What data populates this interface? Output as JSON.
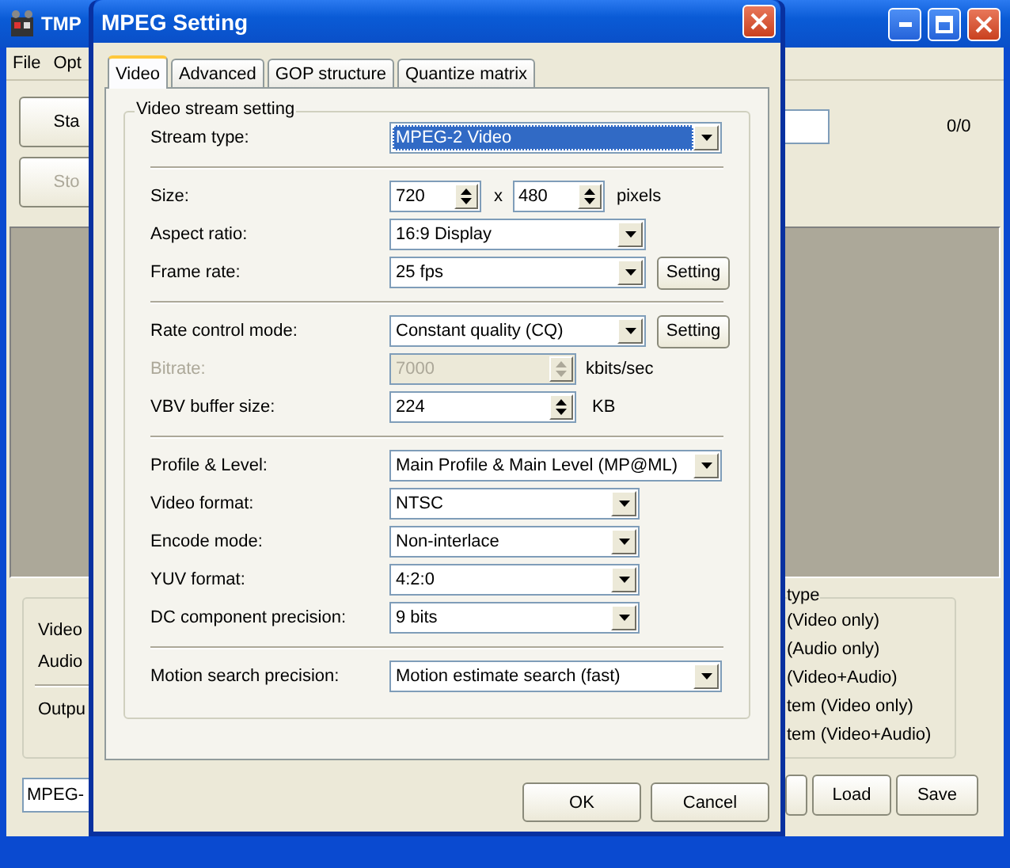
{
  "main_window": {
    "title": "TMP",
    "menu": [
      "File",
      "Opt"
    ],
    "side_buttons": [
      {
        "label": "Sta",
        "disabled": false
      },
      {
        "label": "Sto",
        "disabled": true
      }
    ],
    "counter": "0/0",
    "source_labels": [
      "Video",
      "Audio"
    ],
    "output_label": "Outpu",
    "legend": "type",
    "options": [
      "(Video only)",
      "(Audio only)",
      "(Video+Audio)",
      "tem (Video only)",
      "tem (Video+Audio)"
    ],
    "format_field": "MPEG-",
    "bottom_buttons": [
      "Load",
      "Save"
    ]
  },
  "dialog": {
    "title": "MPEG Setting",
    "tabs": [
      {
        "label": "Video",
        "selected": true
      },
      {
        "label": "Advanced",
        "selected": false
      },
      {
        "label": "GOP structure",
        "selected": false
      },
      {
        "label": "Quantize matrix",
        "selected": false
      }
    ],
    "group_title": "Video stream setting",
    "sections": [
      [
        {
          "label": "Stream type:",
          "kind": "select",
          "value": "MPEG-2 Video",
          "focused": true,
          "disabled": false
        }
      ],
      [
        {
          "label": "Size:",
          "kind": "size",
          "values": [
            "720",
            "480"
          ],
          "separator": "x",
          "unit": "pixels",
          "disabled": false
        },
        {
          "label": "Aspect ratio:",
          "kind": "select",
          "value": "16:9 Display",
          "focused": false,
          "disabled": false
        },
        {
          "label": "Frame rate:",
          "kind": "select",
          "value": "25 fps",
          "focused": false,
          "disabled": false,
          "button": "Setting"
        }
      ],
      [
        {
          "label": "Rate control mode:",
          "kind": "select",
          "value": "Constant quality (CQ)",
          "focused": false,
          "disabled": false,
          "button": "Setting"
        },
        {
          "label": "Bitrate:",
          "kind": "spin",
          "value": "7000",
          "unit": "kbits/sec",
          "disabled": true
        },
        {
          "label": "VBV buffer size:",
          "kind": "spin",
          "value": "224",
          "unit": "KB",
          "disabled": false
        }
      ],
      [
        {
          "label": "Profile & Level:",
          "kind": "select",
          "value": "Main Profile & Main Level (MP@ML)",
          "focused": false,
          "disabled": false
        },
        {
          "label": "Video format:",
          "kind": "select",
          "value": "NTSC",
          "focused": false,
          "disabled": false
        },
        {
          "label": "Encode mode:",
          "kind": "select",
          "value": "Non-interlace",
          "focused": false,
          "disabled": false
        },
        {
          "label": "YUV format:",
          "kind": "select",
          "value": "4:2:0",
          "focused": false,
          "disabled": false
        },
        {
          "label": "DC component precision:",
          "kind": "select",
          "value": "9 bits",
          "focused": false,
          "disabled": false
        }
      ],
      [
        {
          "label": "Motion search precision:",
          "kind": "select",
          "value": "Motion estimate search (fast)",
          "focused": false,
          "disabled": false
        }
      ]
    ],
    "buttons": [
      "OK",
      "Cancel"
    ]
  }
}
